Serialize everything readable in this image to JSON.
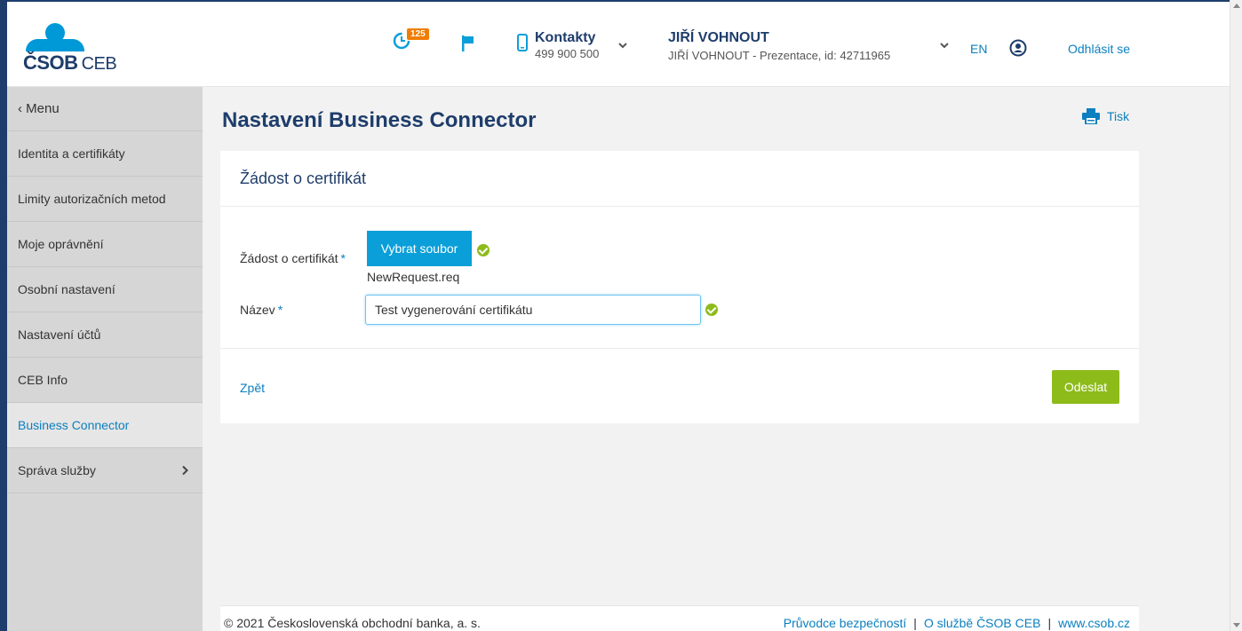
{
  "brand": {
    "logo_main": "ČSOB",
    "logo_sub": "CEB",
    "color_primary": "#1e3d6b",
    "color_accent": "#0b9fd9",
    "color_success": "#8dbb1a"
  },
  "header": {
    "notifications_count": "125",
    "contacts_title": "Kontakty",
    "contacts_phone": "499 900 500",
    "user_name": "JIŘÍ VOHNOUT",
    "user_detail": "JIŘÍ VOHNOUT - Prezentace, id: 42711965",
    "language": "EN",
    "logout": "Odhlásit se",
    "icons": [
      "clock-icon",
      "flag-icon",
      "phone-icon",
      "chevron-down-icon",
      "user-circle-icon"
    ]
  },
  "sidebar": {
    "menu_label": "‹ Menu",
    "items": [
      {
        "label": "Identita a certifikáty"
      },
      {
        "label": "Limity autorizačních metod"
      },
      {
        "label": "Moje oprávnění"
      },
      {
        "label": "Osobní nastavení"
      },
      {
        "label": "Nastavení účtů"
      },
      {
        "label": "CEB Info"
      },
      {
        "label": "Business Connector"
      },
      {
        "label": "Správa služby"
      }
    ]
  },
  "main": {
    "title": "Nastavení Business Connector",
    "print_label": "Tisk",
    "card_title": "Žádost o certifikát",
    "form": {
      "request_label": "Žádost o certifikát",
      "required_mark": "*",
      "choose_file_button": "Vybrat soubor",
      "filename": "NewRequest.req",
      "name_label": "Název",
      "name_value": "Test vygenerování certifikátu"
    },
    "back_link": "Zpět",
    "submit_button": "Odeslat"
  },
  "footer": {
    "copyright": "© 2021 Československá obchodní banka, a. s.",
    "link_security": "Průvodce bezpečností",
    "link_about": "O službě ČSOB CEB",
    "link_site": "www.csob.cz",
    "separator": "|"
  }
}
